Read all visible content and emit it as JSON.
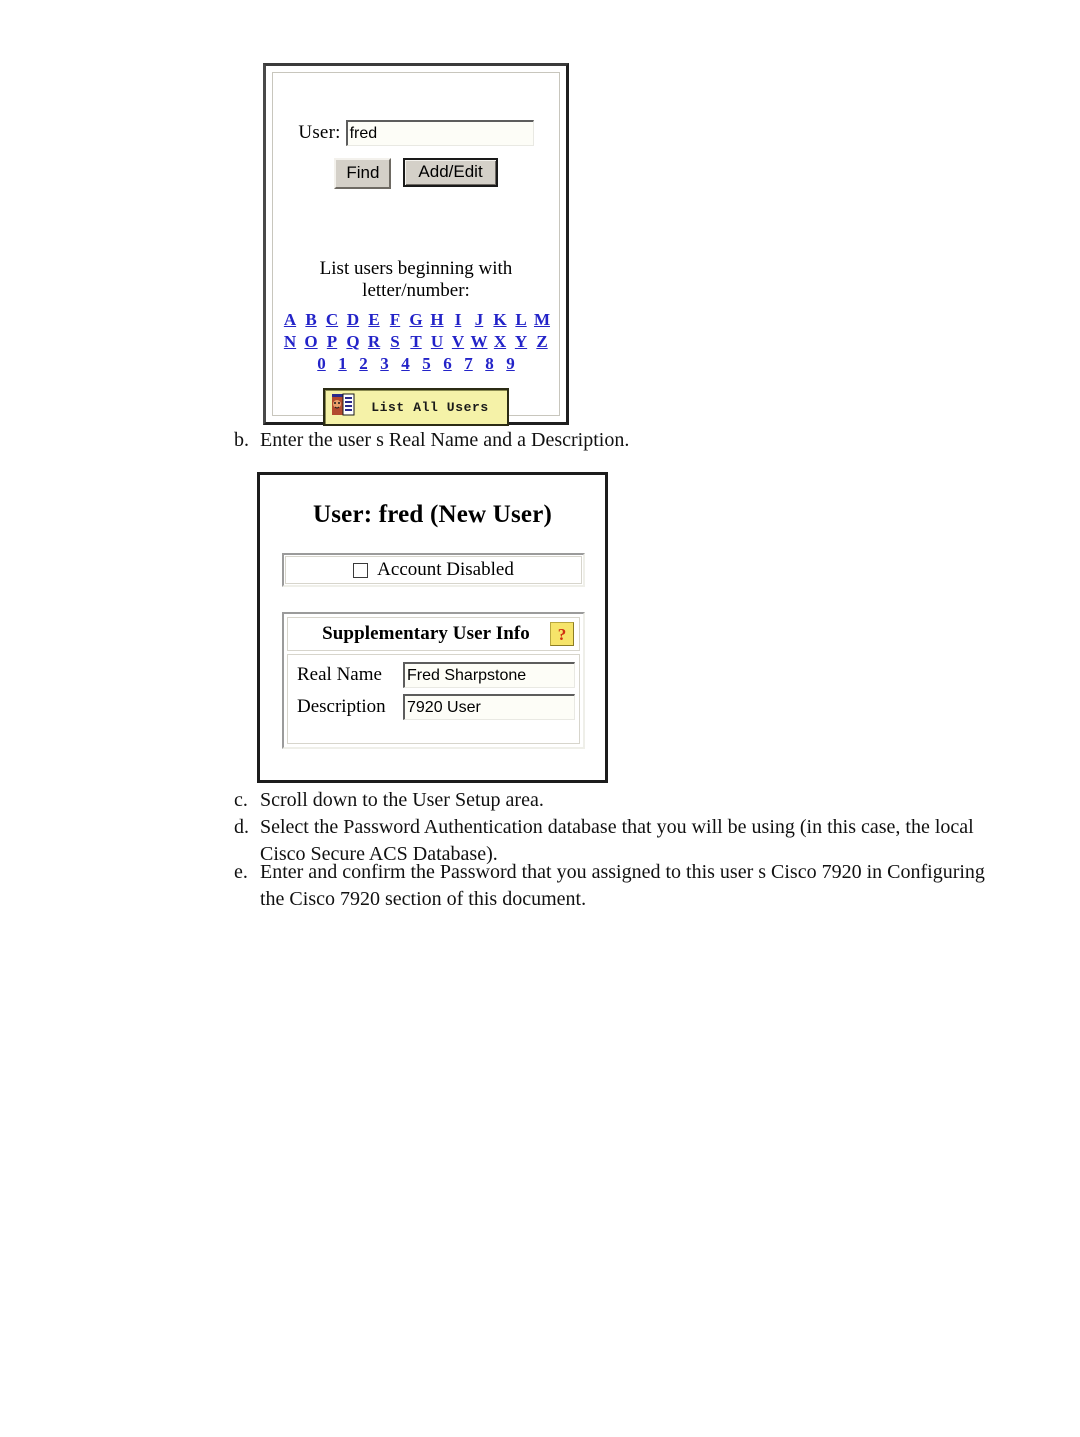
{
  "document": {
    "page_background": "#ffffff"
  },
  "figure_find_user": {
    "user_label": "User:",
    "user_value": "fred",
    "find_button": "Find",
    "add_edit_button": "Add/Edit",
    "list_caption_line1": "List users beginning with",
    "list_caption_line2": "letter/number:",
    "alpha_rows": [
      [
        "A",
        "B",
        "C",
        "D",
        "E",
        "F",
        "G",
        "H",
        "I",
        "J",
        "K",
        "L",
        "M"
      ],
      [
        "N",
        "O",
        "P",
        "Q",
        "R",
        "S",
        "T",
        "U",
        "V",
        "W",
        "X",
        "Y",
        "Z"
      ],
      [
        "0",
        "1",
        "2",
        "3",
        "4",
        "5",
        "6",
        "7",
        "8",
        "9"
      ]
    ],
    "list_all_users_button": "List All Users",
    "link_color": "#2323c8",
    "list_all_button_color": "#f5f2a8"
  },
  "figure_user_setup": {
    "title": "User: fred (New User)",
    "account_disabled_label": "Account Disabled",
    "account_disabled_checked": false,
    "supplementary_header": "Supplementary User Info",
    "help_icon_glyph": "?",
    "fields": [
      {
        "label": "Real Name",
        "value": "Fred Sharpstone"
      },
      {
        "label": "Description",
        "value": "7920 User"
      }
    ],
    "help_icon_background": "#f6e46a",
    "help_icon_color": "#d03010"
  },
  "steps": {
    "b": {
      "marker": "b.",
      "text": "Enter the user s Real Name and a Description."
    },
    "c": {
      "marker": "c.",
      "text": "Scroll down to the User Setup area."
    },
    "d": {
      "marker": "d.",
      "text": "Select the Password Authentication database that you will be using (in this case, the local Cisco Secure ACS Database)."
    },
    "e": {
      "marker": "e.",
      "text": "Enter and confirm the Password that you assigned to this user s Cisco 7920 in Configuring the Cisco 7920 section of this document."
    }
  }
}
